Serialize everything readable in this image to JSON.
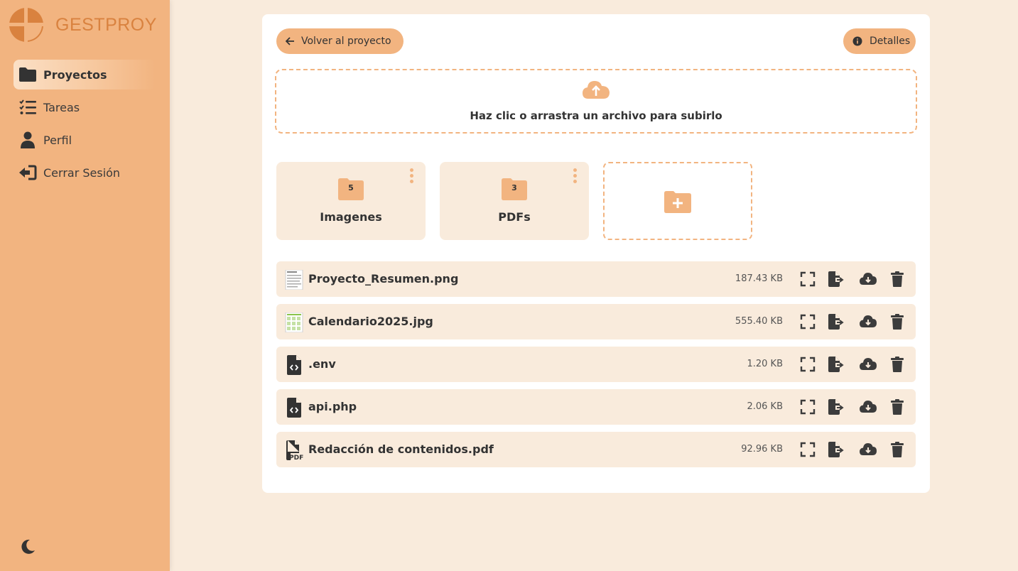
{
  "app": {
    "name": "GESTPROY"
  },
  "sidebar": {
    "items": [
      {
        "label": "Proyectos",
        "icon": "folder-icon",
        "active": true
      },
      {
        "label": "Tareas",
        "icon": "list-check-icon",
        "active": false
      },
      {
        "label": "Perfil",
        "icon": "user-icon",
        "active": false
      },
      {
        "label": "Cerrar Sesión",
        "icon": "logout-icon",
        "active": false
      }
    ],
    "theme_toggle_icon": "moon-icon"
  },
  "toolbar": {
    "back_label": "Volver al proyecto",
    "details_label": "Detalles"
  },
  "upload": {
    "label": "Haz clic o arrastra un archivo para subirlo"
  },
  "folders": [
    {
      "name": "Imagenes",
      "count": "5"
    },
    {
      "name": "PDFs",
      "count": "3"
    }
  ],
  "files": [
    {
      "name": "Proyecto_Resumen.png",
      "size": "187.43 KB",
      "type": "image"
    },
    {
      "name": "Calendario2025.jpg",
      "size": "555.40 KB",
      "type": "image"
    },
    {
      "name": ".env",
      "size": "1.20 KB",
      "type": "code"
    },
    {
      "name": "api.php",
      "size": "2.06 KB",
      "type": "code"
    },
    {
      "name": "Redacción de contenidos.pdf",
      "size": "92.96 KB",
      "type": "pdf"
    }
  ],
  "colors": {
    "accent": "#f2b480",
    "background": "#f9ebdc",
    "logo": "#d9823f",
    "card": "#ffffff",
    "text": "#333333"
  }
}
